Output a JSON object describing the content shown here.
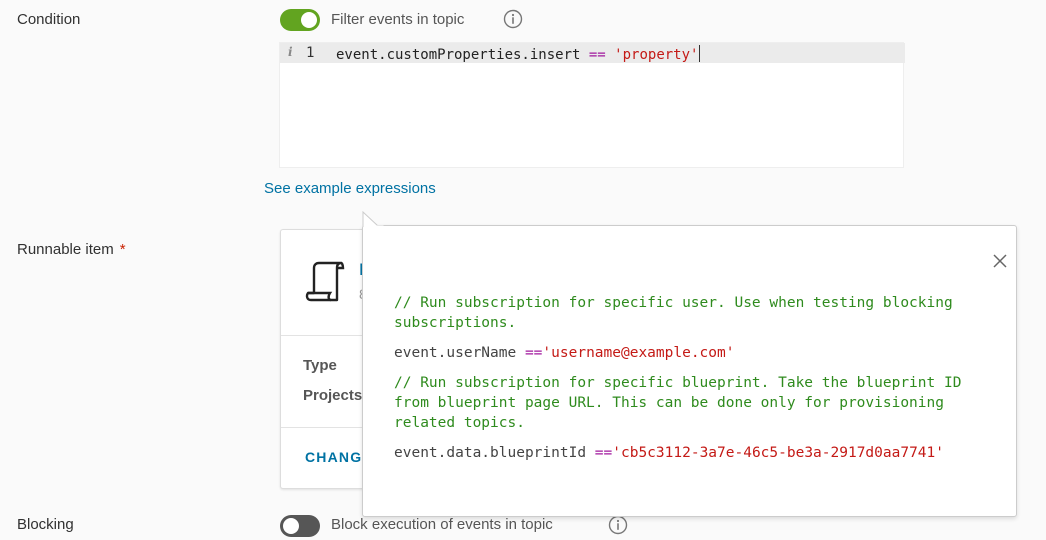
{
  "condition": {
    "label": "Condition",
    "toggle_on": true,
    "toggle_label": "Filter events in topic",
    "editor": {
      "line_number": "1",
      "code_left": "event.customProperties.insert",
      "code_op": "==",
      "code_str": "'property'"
    },
    "example_link": "See example expressions"
  },
  "runnable": {
    "label": "Runnable item",
    "required_mark": "*",
    "name_fragment": "E",
    "sub_fragment": "8",
    "type_label": "Type",
    "projects_label": "Projects",
    "change_button": "CHANG"
  },
  "blocking": {
    "label": "Blocking",
    "toggle_on": false,
    "toggle_label": "Block execution of events in topic"
  },
  "popover": {
    "comment1": "// Run subscription for specific user. Use when testing blocking subscriptions.",
    "code1_left": "event.userName ",
    "code1_op": "==",
    "code1_str": "'username@example.com'",
    "comment2": "// Run subscription for specific blueprint. Take the blueprint ID from blueprint page URL. This can be done only for provisioning related topics.",
    "code2_left": "event.data.blueprintId ",
    "code2_op": "==",
    "code2_str": "'cb5c3112-3a7e-46c5-be3a-2917d0aa7741'"
  },
  "colors": {
    "toggle_on": "#62a420",
    "toggle_off": "#565656",
    "link": "#0072a3",
    "comment": "#2f8b1e",
    "string": "#c41a16",
    "operator": "#a0179d"
  },
  "icons": [
    "info-icon",
    "script-icon",
    "close-icon"
  ]
}
